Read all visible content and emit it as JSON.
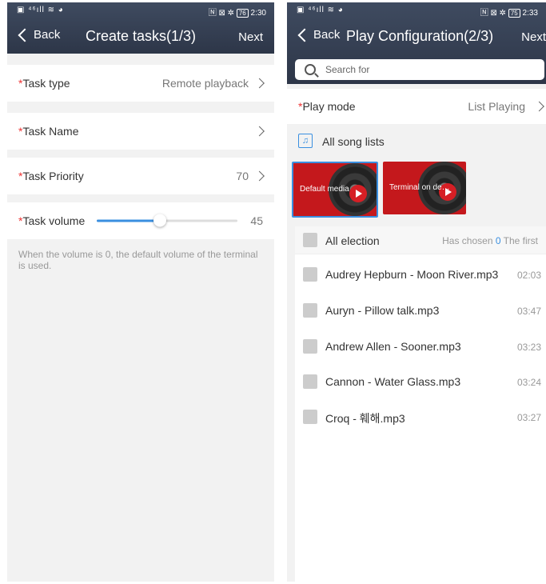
{
  "left": {
    "status": {
      "left": "▣ ⁴⁶ıll ≋ ◕",
      "right_icons": "🄽 ⊠ ✲",
      "battery": "76",
      "time": "2:30"
    },
    "nav": {
      "back": "Back",
      "title": "Create tasks(1/3)",
      "next": "Next"
    },
    "rows": {
      "task_type": {
        "required": "*",
        "label": "Task type",
        "value": "Remote playback"
      },
      "task_name": {
        "required": "*",
        "label": "Task Name"
      },
      "task_priority": {
        "required": "*",
        "label": "Task Priority",
        "value": "70"
      },
      "task_volume": {
        "required": "*",
        "label": "Task volume",
        "value": "45",
        "fraction": 0.45
      }
    },
    "note": "When the volume is 0, the default volume of the terminal is used."
  },
  "right": {
    "status": {
      "left": "▣ ⁴⁶ıll ≋ ◕",
      "right_icons": "🄽 ⊠ ✲",
      "battery": "75",
      "time": "2:33"
    },
    "nav": {
      "back": "Back",
      "title": "Play Configuration(2/3)",
      "next": "Next"
    },
    "search": {
      "placeholder": "Search for"
    },
    "play_mode": {
      "required": "*",
      "label": "Play mode",
      "value": "List Playing"
    },
    "song_lists_title": "All song lists",
    "song_lists": [
      {
        "name": "Default media",
        "selected": true
      },
      {
        "name": "Terminal on demand",
        "selected": false
      }
    ],
    "list_header": {
      "all": "All election",
      "chosen_prefix": "Has chosen",
      "chosen_count": "0",
      "chosen_suffix": "The first"
    },
    "songs": [
      {
        "name": "Audrey Hepburn - Moon River.mp3",
        "duration": "02:03"
      },
      {
        "name": "Auryn - Pillow talk.mp3",
        "duration": "03:47"
      },
      {
        "name": "Andrew Allen - Sooner.mp3",
        "duration": "03:23"
      },
      {
        "name": "Cannon - Water Glass.mp3",
        "duration": "03:24"
      },
      {
        "name": "Croq - 훼해.mp3",
        "duration": "03:27"
      }
    ],
    "colors": {
      "accent": "#3a8fe0",
      "required": "#e33333",
      "card": "#c4181c"
    }
  }
}
